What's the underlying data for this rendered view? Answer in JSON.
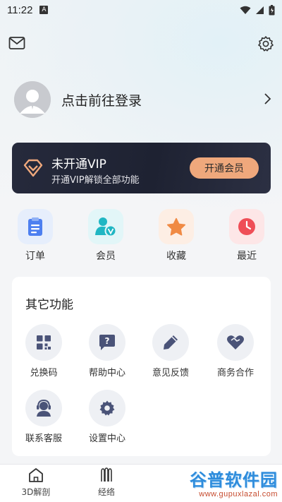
{
  "status_bar": {
    "time": "11:22",
    "notification_letter": "A"
  },
  "header": {
    "mail_icon": "mail-icon",
    "settings_icon": "gear-icon"
  },
  "profile": {
    "login_prompt": "点击前往登录"
  },
  "vip": {
    "title": "未开通VIP",
    "subtitle": "开通VIP解锁全部功能",
    "button_label": "开通会员",
    "button_color": "#efa87c",
    "card_color": "#232738"
  },
  "quick_actions": [
    {
      "label": "订单",
      "icon": "order-clipboard-icon",
      "color": "#4d7ff0"
    },
    {
      "label": "会员",
      "icon": "member-badge-icon",
      "color": "#1fb6c3"
    },
    {
      "label": "收藏",
      "icon": "star-icon",
      "color": "#f08a44"
    },
    {
      "label": "最近",
      "icon": "clock-icon",
      "color": "#ef4e57"
    }
  ],
  "other_functions": {
    "title": "其它功能",
    "items": [
      {
        "label": "兑换码",
        "icon": "redeem-code-icon"
      },
      {
        "label": "帮助中心",
        "icon": "help-chat-icon"
      },
      {
        "label": "意见反馈",
        "icon": "feedback-pencil-icon"
      },
      {
        "label": "商务合作",
        "icon": "handshake-heart-icon"
      },
      {
        "label": "联系客服",
        "icon": "customer-service-icon"
      },
      {
        "label": "设置中心",
        "icon": "gear-icon"
      }
    ]
  },
  "bottom_nav": [
    {
      "label": "3D解剖",
      "icon": "home-icon"
    },
    {
      "label": "经络",
      "icon": "meridian-icon"
    }
  ],
  "watermark": {
    "title": "谷普软件园",
    "url": "www.gupuxlazal.com"
  }
}
